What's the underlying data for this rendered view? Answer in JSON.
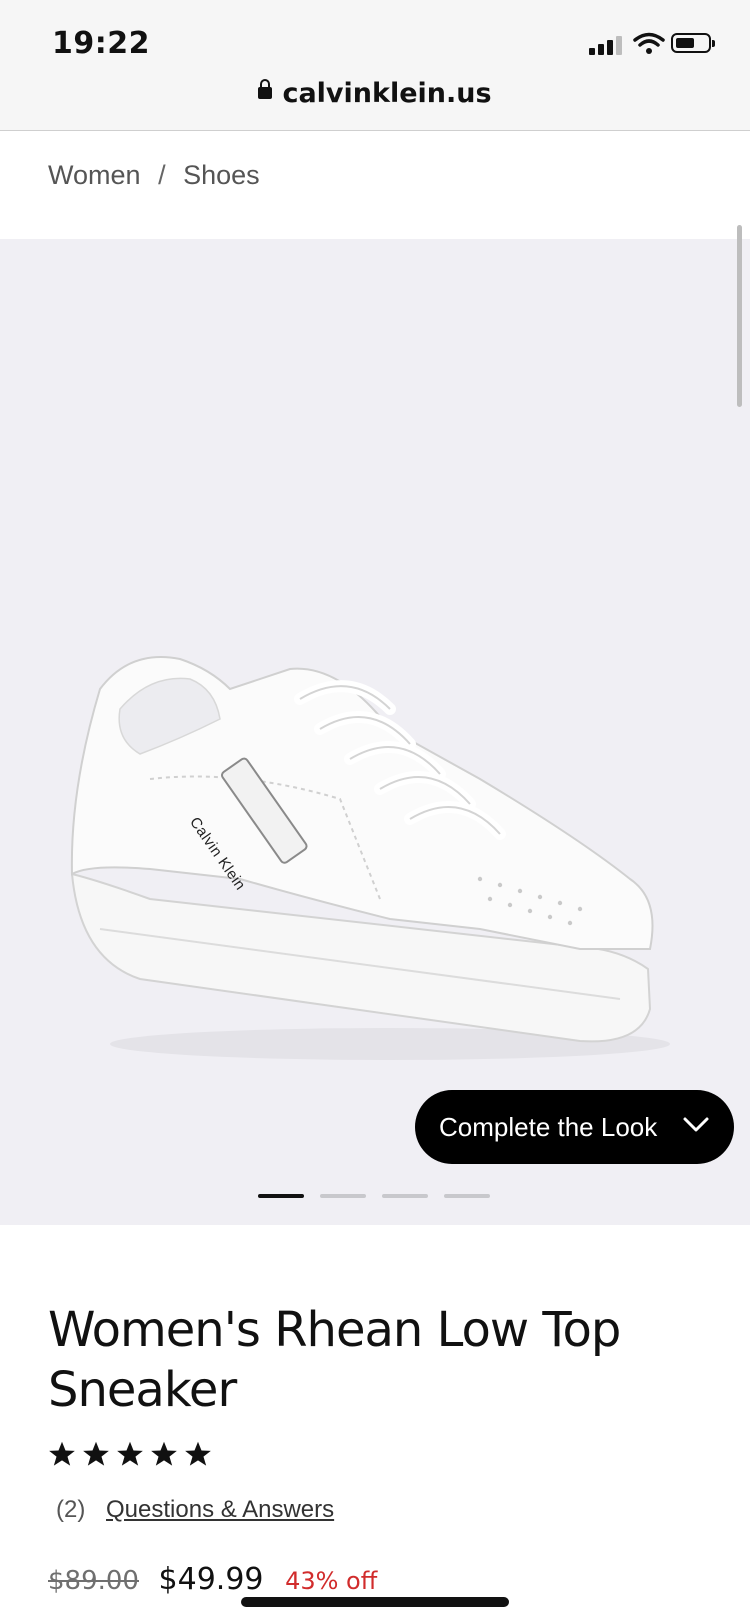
{
  "status_bar": {
    "time": "19:22"
  },
  "browser": {
    "url": "calvinklein.us"
  },
  "breadcrumb": {
    "items": [
      "Women",
      "Shoes"
    ],
    "separator": "/"
  },
  "gallery": {
    "complete_look_label": "Complete the Look",
    "brand_on_shoe": "Calvin Klein",
    "slides_total": 4,
    "active_slide": 1
  },
  "product": {
    "title": "Women's Rhean Low Top Sneaker",
    "rating_stars": 5,
    "reviews_count": "(2)",
    "qa_link": "Questions & Answers",
    "price_original": "$89.00",
    "price_sale": "$49.99",
    "discount": "43% off"
  },
  "colors": {
    "gallery_bg": "#f0eff4",
    "button_bg": "#000000",
    "discount": "#d12c2c"
  },
  "icons": [
    "lock-icon",
    "signal-icon",
    "wifi-icon",
    "battery-icon",
    "chevron-down-icon",
    "star-icon"
  ]
}
